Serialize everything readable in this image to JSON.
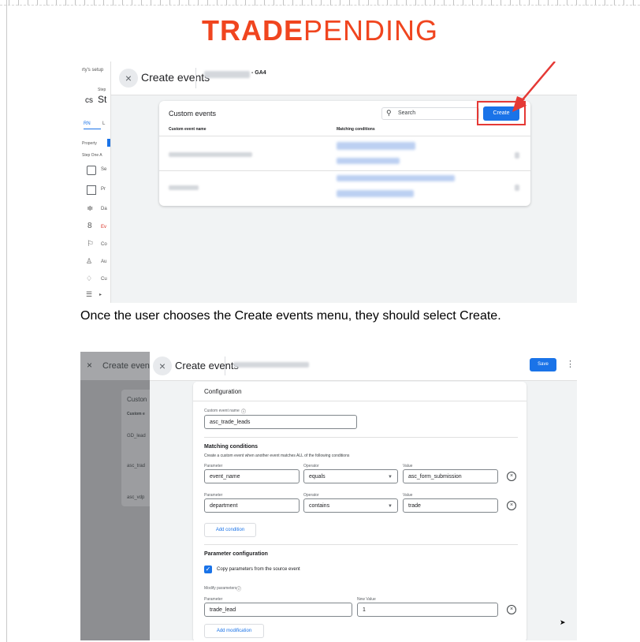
{
  "logo": {
    "bold": "TRADE",
    "light": "PENDING"
  },
  "caption": "Once the user chooses the Create events menu, they should select Create.",
  "shot1": {
    "left_snips": [
      "rty's setup",
      "Step",
      "cs",
      "St",
      "RN",
      "L",
      "Property",
      "Step One A",
      "Se",
      "Pr",
      "Da",
      "Ev",
      "Co",
      "Au",
      "Cu"
    ],
    "close_icon": "×",
    "panel_title": "Create events",
    "property_suffix": "- GA4",
    "card_title": "Custom events",
    "search_placeholder": "Search",
    "create_label": "Create",
    "col_name": "Custom event name",
    "col_conditions": "Matching conditions",
    "colors": {
      "accent": "#1a73e8",
      "highlight": "#e53935"
    }
  },
  "shot2": {
    "back_title": "Create event",
    "back_snips": [
      "Custon",
      "Custom e",
      "GD_lead",
      "asc_trad",
      "asc_vdp"
    ],
    "panel_title": "Create events",
    "save_label": "Save",
    "more_icon": "⋮",
    "config_title": "Configuration",
    "event_name_label": "Custom event name",
    "event_name_value": "asc_trade_leads",
    "matching_title": "Matching conditions",
    "matching_desc": "Create a custom event when another event matches ALL of the following conditions",
    "conditions": [
      {
        "param_label": "Parameter",
        "param": "event_name",
        "op_label": "Operator",
        "op": "equals",
        "val_label": "Value",
        "val": "asc_form_submission"
      },
      {
        "param_label": "Parameter",
        "param": "department",
        "op_label": "Operator",
        "op": "contains",
        "val_label": "Value",
        "val": "trade"
      }
    ],
    "add_condition": "Add condition",
    "param_config_title": "Parameter configuration",
    "copy_params_label": "Copy parameters from the source event",
    "copy_params_checked": true,
    "modify_label": "Modify parameters",
    "modification": {
      "param_label": "Parameter",
      "param": "trade_lead",
      "new_value_label": "New Value",
      "new_value": "1"
    },
    "add_modification": "Add modification"
  }
}
